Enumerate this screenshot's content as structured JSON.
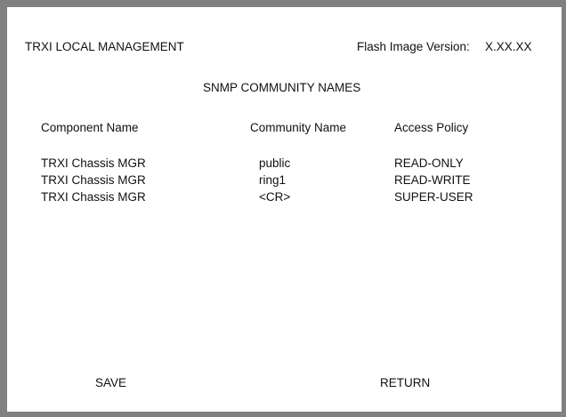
{
  "header": {
    "title": "TRXI LOCAL MANAGEMENT",
    "flash_label": "Flash Image Version:",
    "flash_value": "X.XX.XX"
  },
  "screen_title": "SNMP COMMUNITY NAMES",
  "table": {
    "columns": [
      "Component Name",
      "Community Name",
      "Access Policy"
    ],
    "rows": [
      {
        "component": "TRXI Chassis MGR",
        "community": "public",
        "access": "READ-ONLY"
      },
      {
        "component": "TRXI Chassis MGR",
        "community": "ring1",
        "access": "READ-WRITE"
      },
      {
        "component": "TRXI Chassis MGR",
        "community": "<CR>",
        "access": "SUPER-USER"
      }
    ]
  },
  "commands": {
    "save": "SAVE",
    "return": "RETURN"
  },
  "colors": {
    "frame": "#808080",
    "background": "#ffffff",
    "text": "#111111"
  }
}
